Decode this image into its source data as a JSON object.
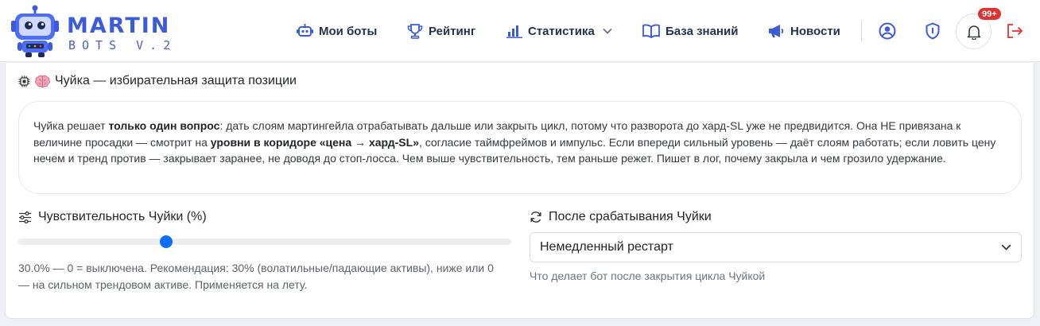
{
  "brand": {
    "title": "MARTIN",
    "subtitle": "BOTS V.2",
    "primary_color": "#3b5bdb"
  },
  "nav": {
    "items": [
      {
        "label": "Мои боты",
        "icon": "robot-icon"
      },
      {
        "label": "Рейтинг",
        "icon": "trophy-icon"
      },
      {
        "label": "Статистика",
        "icon": "bar-chart-icon",
        "has_dropdown": true
      },
      {
        "label": "База знаний",
        "icon": "book-icon"
      },
      {
        "label": "Новости",
        "icon": "megaphone-icon"
      }
    ]
  },
  "header_actions": {
    "icons": [
      "user-circle-icon",
      "shield-icon",
      "bell-icon",
      "logout-icon"
    ],
    "notification_badge": "99+",
    "logout_color": "#e03131"
  },
  "section": {
    "title": "Чуйка — избирательная защита позиции",
    "description": [
      {
        "text": "Чуйка решает ",
        "bold": false
      },
      {
        "text": "только один вопрос",
        "bold": true
      },
      {
        "text": ": дать слоям мартингейла отрабатывать дальше или закрыть цикл, потому что разворота до хард-SL уже не предвидится. Она НЕ привязана к величине просадки — смотрит на ",
        "bold": false
      },
      {
        "text": "уровни в коридоре «цена → хард-SL»",
        "bold": true
      },
      {
        "text": ", согласие таймфреймов и импульс. Если впереди сильный уровень — даёт слоям работать; если ловить цену нечем и тренд против — закрывает заранее, не доводя до стоп-лосса. Чем выше чувствительность, тем раньше режет. Пишет в лог, почему закрыла и чем грозило удержание.",
        "bold": false
      }
    ]
  },
  "sensitivity": {
    "label": "Чувствительность Чуйки (%)",
    "value_fraction": 0.3,
    "help": "30.0% — 0 = выключена. Рекомендация: 30% (волатильные/падающие активы), ниже или 0 — на сильном трендовом активе. Применяется на лету."
  },
  "after_trigger": {
    "label": "После срабатывания Чуйки",
    "selected": "Немедленный рестарт",
    "help": "Что делает бот после закрытия цикла Чуйкой"
  }
}
